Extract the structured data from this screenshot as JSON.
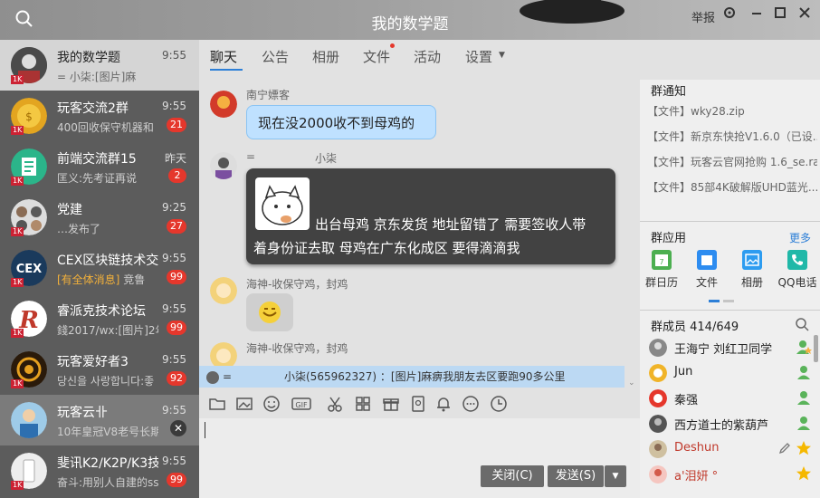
{
  "window": {
    "title": "我的数学题",
    "report_label": "举报",
    "controls": [
      "gear-icon",
      "minimize-icon",
      "maximize-icon",
      "close-icon"
    ]
  },
  "sessions": [
    {
      "name": "我的数学题",
      "time": "9:55",
      "preview": "=        小柒:[图片]麻",
      "level": "1K",
      "state": "active"
    },
    {
      "name": "玩客交流2群",
      "time": "9:55",
      "preview": "400回收保守机器和",
      "badge": "21",
      "level": "1K"
    },
    {
      "name": "前端交流群15",
      "time": "昨天",
      "preview": "匡义:先考证再说",
      "badge": "2",
      "level": "1K"
    },
    {
      "name": "党建",
      "time": "9:25",
      "preview": "…发布了",
      "badge": "27",
      "level": "1K"
    },
    {
      "name": "CEX区块链技术交",
      "time": "9:55",
      "preview_highlight": "[有全体消息]",
      "preview": "竞鲁",
      "badge": "99",
      "level": "1K"
    },
    {
      "name": "睿派克技术论坛",
      "time": "9:55",
      "preview": "錢2017/wx:[图片]2年",
      "badge": "99",
      "level": "1K"
    },
    {
      "name": "玩客爱好者3",
      "time": "9:55",
      "preview": "당신을 사랑합니다:좋",
      "badge": "92",
      "level": "1K"
    },
    {
      "name": "玩客云卝",
      "time": "9:55",
      "preview": "10年皇冠V8老号长期",
      "state": "hover"
    },
    {
      "name": "斐讯K2/K2P/K3技",
      "time": "9:55",
      "preview": "奋斗:用别人自建的ss",
      "badge": "99",
      "level": "1K"
    }
  ],
  "tabs": [
    {
      "label": "聊天",
      "active": true
    },
    {
      "label": "公告"
    },
    {
      "label": "相册"
    },
    {
      "label": "文件",
      "dot": true
    },
    {
      "label": "活动"
    },
    {
      "label": "设置",
      "dropdown": true
    }
  ],
  "messages": [
    {
      "sender": "南宁嫖客",
      "text": "现在没2000收不到母鸡的",
      "style": "blue"
    },
    {
      "sender_prefix": "=",
      "sender": "小柒",
      "text_line1": "出台母鸡  京东发货 地址留错了 需要签收人带",
      "text_line2": "着身份证去取 母鸡在广东化成区  要得滴滴我",
      "style": "dark"
    },
    {
      "sender": "海神-收保守鸡，封鸡",
      "sticker": "smile-emoji-icon",
      "style": "grey"
    },
    {
      "sender": "海神-收保守鸡，封鸡"
    }
  ],
  "notice_bar": {
    "prefix": "=",
    "text": "小柒(565962327) ：[图片]麻痹我朋友去区要跑90多公里"
  },
  "toolbar_icons": [
    "folder-icon",
    "image-icon",
    "emoji-icon",
    "gif-icon",
    "scissors-icon",
    "apps-icon",
    "gift-icon",
    "red-packet-icon",
    "bell-icon",
    "more-icon",
    "history-icon"
  ],
  "buttons": {
    "close": "关闭(C)",
    "send": "发送(S)"
  },
  "right": {
    "notice_title": "群通知",
    "notices": [
      "【文件】wky28.zip",
      "【文件】新京东快抢V1.6.0（已设...",
      "【文件】玩客云官网抢购 1.6_se.rar",
      "【文件】85部4K破解版UHD蓝光..."
    ],
    "apps_title": "群应用",
    "apps_more": "更多",
    "apps": [
      {
        "label": "群日历",
        "icon": "calendar-icon",
        "color": "#4caf50"
      },
      {
        "label": "文件",
        "icon": "file-icon",
        "color": "#2d8cf0"
      },
      {
        "label": "相册",
        "icon": "album-icon",
        "color": "#2d9cf0"
      },
      {
        "label": "QQ电话",
        "icon": "phone-icon",
        "color": "#20b8a8"
      }
    ],
    "members_title": "群成员 414/649",
    "members": [
      {
        "name": "王海宁 刘红卫同学",
        "role": "admin"
      },
      {
        "name": "Jun",
        "role": "member"
      },
      {
        "name": "秦强",
        "role": "member"
      },
      {
        "name": "西方道士的紫葫芦",
        "role": "member"
      },
      {
        "name": "Deshun",
        "role": "owner",
        "color": "#c0392b"
      },
      {
        "name": "a'泪妍 °",
        "role": "owner",
        "color": "#c0392b"
      }
    ]
  },
  "colors": {
    "accent": "#2d7fd7",
    "badge": "#e5372c",
    "sidebar": "#5c5c5c"
  }
}
